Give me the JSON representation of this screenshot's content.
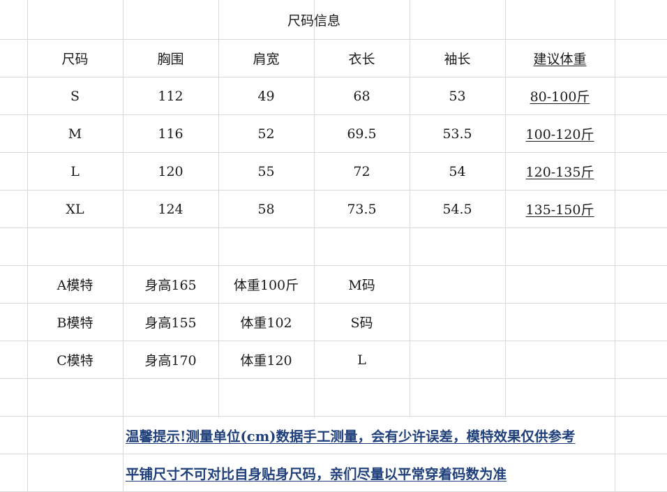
{
  "title": "尺码信息",
  "size_table": {
    "headers": [
      "尺码",
      "胸围",
      "肩宽",
      "衣长",
      "袖长",
      "建议体重"
    ],
    "rows": [
      [
        "S",
        "112",
        "49",
        "68",
        "53",
        "80-100斤"
      ],
      [
        "M",
        "116",
        "52",
        "69.5",
        "53.5",
        "100-120斤"
      ],
      [
        "L",
        "120",
        "55",
        "72",
        "54",
        "120-135斤"
      ],
      [
        "XL",
        "124",
        "58",
        "73.5",
        "54.5",
        "135-150斤"
      ]
    ]
  },
  "models": [
    [
      "A模特",
      "身高165",
      "体重100斤",
      "M码"
    ],
    [
      "B模特",
      "身高155",
      "体重102",
      "S码"
    ],
    [
      "C模特",
      "身高170",
      "体重120",
      "L"
    ]
  ],
  "notes": [
    "温馨提示!测量单位(cm)数据手工测量，会有少许误差，模特效果仅供参考",
    "平铺尺寸不可对比自身贴身尺码，亲们尽量以平常穿着码数为准"
  ],
  "colors": {
    "grid": "#d9d9d9",
    "text": "#1a1a1a",
    "note": "#1f3f7a"
  }
}
